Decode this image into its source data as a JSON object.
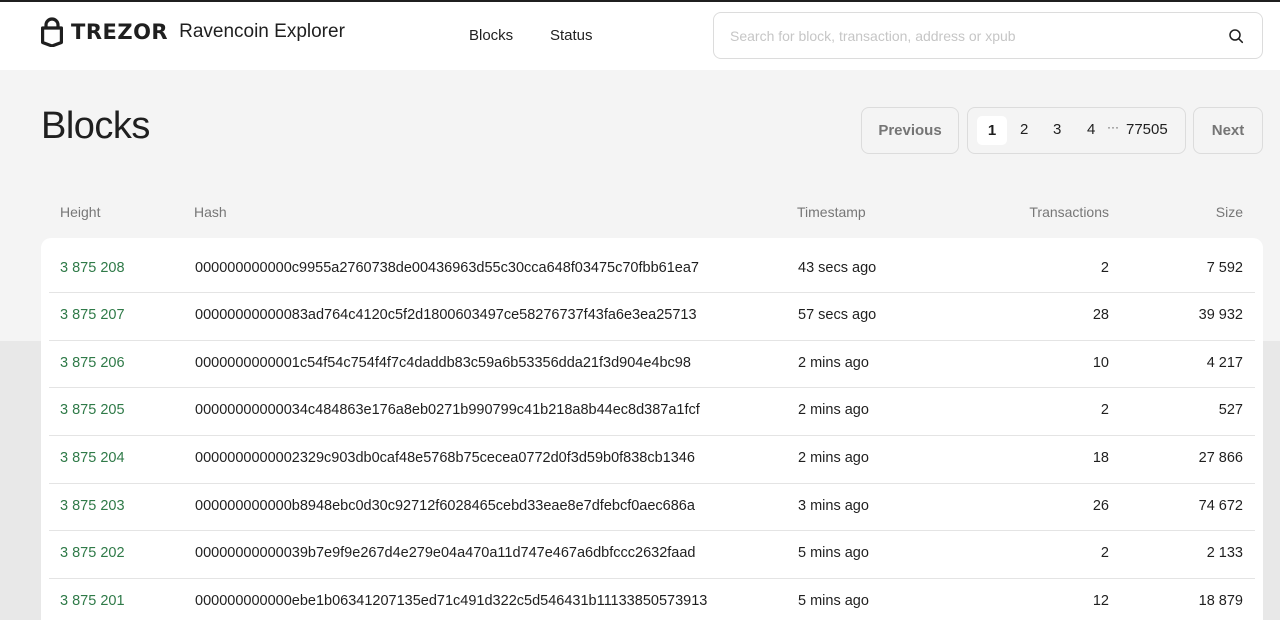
{
  "header": {
    "brand": "TREZOR",
    "app_name": "Ravencoin Explorer",
    "nav": {
      "blocks": "Blocks",
      "status": "Status"
    },
    "search": {
      "placeholder": "Search for block, transaction, address or xpub",
      "value": ""
    }
  },
  "page": {
    "title": "Blocks"
  },
  "pagination": {
    "previous": "Previous",
    "next": "Next",
    "pages": [
      "1",
      "2",
      "3",
      "4"
    ],
    "ellipsis": "···",
    "last": "77505",
    "current": "1"
  },
  "table": {
    "columns": [
      "Height",
      "Hash",
      "Timestamp",
      "Transactions",
      "Size"
    ],
    "rows": [
      {
        "height": "3 875 208",
        "hash": "000000000000c9955a2760738de00436963d55c30cca648f03475c70fbb61ea7",
        "timestamp": "43 secs ago",
        "transactions": "2",
        "size": "7 592"
      },
      {
        "height": "3 875 207",
        "hash": "00000000000083ad764c4120c5f2d1800603497ce58276737f43fa6e3ea25713",
        "timestamp": "57 secs ago",
        "transactions": "28",
        "size": "39 932"
      },
      {
        "height": "3 875 206",
        "hash": "0000000000001c54f54c754f4f7c4daddb83c59a6b53356dda21f3d904e4bc98",
        "timestamp": "2 mins ago",
        "transactions": "10",
        "size": "4 217"
      },
      {
        "height": "3 875 205",
        "hash": "00000000000034c484863e176a8eb0271b990799c41b218a8b44ec8d387a1fcf",
        "timestamp": "2 mins ago",
        "transactions": "2",
        "size": "527"
      },
      {
        "height": "3 875 204",
        "hash": "0000000000002329c903db0caf48e5768b75cecea0772d0f3d59b0f838cb1346",
        "timestamp": "2 mins ago",
        "transactions": "18",
        "size": "27 866"
      },
      {
        "height": "3 875 203",
        "hash": "000000000000b8948ebc0d30c92712f6028465cebd33eae8e7dfebcf0aec686a",
        "timestamp": "3 mins ago",
        "transactions": "26",
        "size": "74 672"
      },
      {
        "height": "3 875 202",
        "hash": "00000000000039b7e9f9e267d4e279e04a470a11d747e467a6dbfccc2632faad",
        "timestamp": "5 mins ago",
        "transactions": "2",
        "size": "2 133"
      },
      {
        "height": "3 875 201",
        "hash": "000000000000ebe1b06341207135ed71c491d322c5d546431b11133850573913",
        "timestamp": "5 mins ago",
        "transactions": "12",
        "size": "18 879"
      }
    ]
  },
  "colors": {
    "link_green": "#2f7a48",
    "text": "#1f1f1f",
    "muted": "#777777"
  },
  "icons": {
    "logo": "lock-icon",
    "search": "search-icon"
  }
}
